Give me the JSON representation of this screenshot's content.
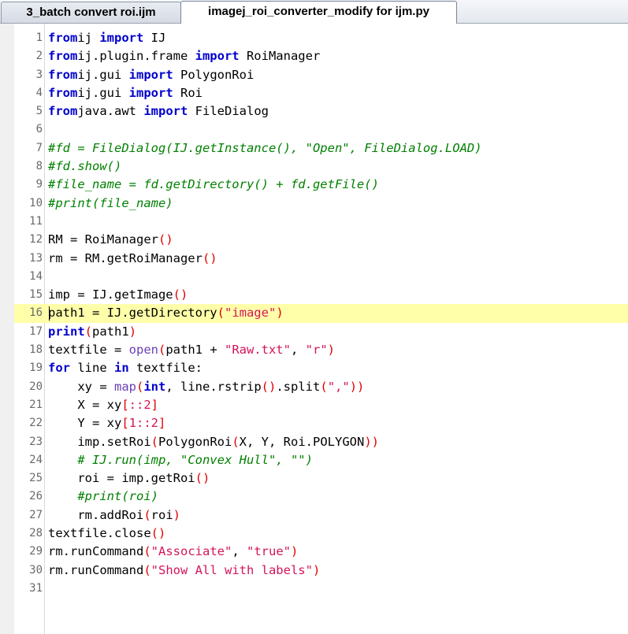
{
  "tabs": [
    {
      "label": "3_batch convert roi.ijm",
      "active": false
    },
    {
      "label": "imagej_roi_converter_modify for ijm.py",
      "active": true
    }
  ],
  "highlighted_line": 16,
  "lines": [
    {
      "n": "1",
      "segs": [
        [
          "kw",
          "from"
        ],
        [
          "",
          "ij "
        ],
        [
          "kw",
          "import"
        ],
        [
          "",
          " IJ"
        ]
      ]
    },
    {
      "n": "2",
      "segs": [
        [
          "kw",
          "from"
        ],
        [
          "",
          "ij.plugin.frame "
        ],
        [
          "kw",
          "import"
        ],
        [
          "",
          " RoiManager"
        ]
      ]
    },
    {
      "n": "3",
      "segs": [
        [
          "kw",
          "from"
        ],
        [
          "",
          "ij.gui "
        ],
        [
          "kw",
          "import"
        ],
        [
          "",
          " PolygonRoi"
        ]
      ]
    },
    {
      "n": "4",
      "segs": [
        [
          "kw",
          "from"
        ],
        [
          "",
          "ij.gui "
        ],
        [
          "kw",
          "import"
        ],
        [
          "",
          " Roi"
        ]
      ]
    },
    {
      "n": "5",
      "segs": [
        [
          "kw",
          "from"
        ],
        [
          "",
          "java.awt "
        ],
        [
          "kw",
          "import"
        ],
        [
          "",
          " FileDialog"
        ]
      ]
    },
    {
      "n": "6",
      "segs": []
    },
    {
      "n": "7",
      "segs": [
        [
          "cm",
          "#fd = FileDialog(IJ.getInstance(), \"Open\", FileDialog.LOAD)"
        ]
      ]
    },
    {
      "n": "8",
      "segs": [
        [
          "cm",
          "#fd.show()"
        ]
      ]
    },
    {
      "n": "9",
      "segs": [
        [
          "cm",
          "#file_name = fd.getDirectory() + fd.getFile()"
        ]
      ]
    },
    {
      "n": "10",
      "segs": [
        [
          "cm",
          "#print(file_name)"
        ]
      ]
    },
    {
      "n": "11",
      "segs": []
    },
    {
      "n": "12",
      "segs": [
        [
          "",
          "RM = RoiManager"
        ],
        [
          "paren",
          "()"
        ]
      ]
    },
    {
      "n": "13",
      "segs": [
        [
          "",
          "rm = RM.getRoiManager"
        ],
        [
          "paren",
          "()"
        ]
      ]
    },
    {
      "n": "14",
      "segs": []
    },
    {
      "n": "15",
      "segs": [
        [
          "",
          "imp = IJ.getImage"
        ],
        [
          "paren",
          "()"
        ]
      ]
    },
    {
      "n": "16",
      "segs": [
        [
          "",
          "path1 = IJ.getDirectory"
        ],
        [
          "paren",
          "("
        ],
        [
          "str",
          "\"image\""
        ],
        [
          "paren",
          ")"
        ]
      ]
    },
    {
      "n": "17",
      "segs": [
        [
          "kw",
          "print"
        ],
        [
          "paren",
          "("
        ],
        [
          "",
          "path1"
        ],
        [
          "paren",
          ")"
        ]
      ]
    },
    {
      "n": "18",
      "segs": [
        [
          "",
          "textfile = "
        ],
        [
          "fn",
          "open"
        ],
        [
          "paren",
          "("
        ],
        [
          "",
          "path1 + "
        ],
        [
          "str",
          "\"Raw.txt\""
        ],
        [
          "",
          ", "
        ],
        [
          "str",
          "\"r\""
        ],
        [
          "paren",
          ")"
        ]
      ]
    },
    {
      "n": "19",
      "segs": [
        [
          "kw",
          "for"
        ],
        [
          "",
          " line "
        ],
        [
          "kw",
          "in"
        ],
        [
          "",
          " textfile:"
        ]
      ]
    },
    {
      "n": "20",
      "segs": [
        [
          "",
          "    xy = "
        ],
        [
          "fn",
          "map"
        ],
        [
          "paren",
          "("
        ],
        [
          "kw",
          "int"
        ],
        [
          "",
          ", line.rstrip"
        ],
        [
          "paren",
          "()"
        ],
        [
          "",
          ".split"
        ],
        [
          "paren",
          "("
        ],
        [
          "str",
          "\",\""
        ],
        [
          "paren",
          "))"
        ]
      ]
    },
    {
      "n": "21",
      "segs": [
        [
          "",
          "    X = xy"
        ],
        [
          "paren",
          "["
        ],
        [
          "str",
          "::2"
        ],
        [
          "paren",
          "]"
        ]
      ]
    },
    {
      "n": "22",
      "segs": [
        [
          "",
          "    Y = xy"
        ],
        [
          "paren",
          "["
        ],
        [
          "str",
          "1::2"
        ],
        [
          "paren",
          "]"
        ]
      ]
    },
    {
      "n": "23",
      "segs": [
        [
          "",
          "    imp.setRoi"
        ],
        [
          "paren",
          "("
        ],
        [
          "",
          "PolygonRoi"
        ],
        [
          "paren",
          "("
        ],
        [
          "",
          "X, Y, Roi.POLYGON"
        ],
        [
          "paren",
          "))"
        ]
      ]
    },
    {
      "n": "24",
      "segs": [
        [
          "",
          "    "
        ],
        [
          "cm",
          "# IJ.run(imp, \"Convex Hull\", \"\")"
        ]
      ]
    },
    {
      "n": "25",
      "segs": [
        [
          "",
          "    roi = imp.getRoi"
        ],
        [
          "paren",
          "()"
        ]
      ]
    },
    {
      "n": "26",
      "segs": [
        [
          "",
          "    "
        ],
        [
          "cm",
          "#print(roi)"
        ]
      ]
    },
    {
      "n": "27",
      "segs": [
        [
          "",
          "    rm.addRoi"
        ],
        [
          "paren",
          "("
        ],
        [
          "",
          "roi"
        ],
        [
          "paren",
          ")"
        ]
      ]
    },
    {
      "n": "28",
      "segs": [
        [
          "",
          "textfile.close"
        ],
        [
          "paren",
          "()"
        ]
      ]
    },
    {
      "n": "29",
      "segs": [
        [
          "",
          "rm.runCommand"
        ],
        [
          "paren",
          "("
        ],
        [
          "str",
          "\"Associate\""
        ],
        [
          "",
          ", "
        ],
        [
          "str",
          "\"true\""
        ],
        [
          "paren",
          ")"
        ]
      ]
    },
    {
      "n": "30",
      "segs": [
        [
          "",
          "rm.runCommand"
        ],
        [
          "paren",
          "("
        ],
        [
          "str",
          "\"Show All with labels\""
        ],
        [
          "paren",
          ")"
        ]
      ]
    },
    {
      "n": "31",
      "segs": []
    }
  ]
}
